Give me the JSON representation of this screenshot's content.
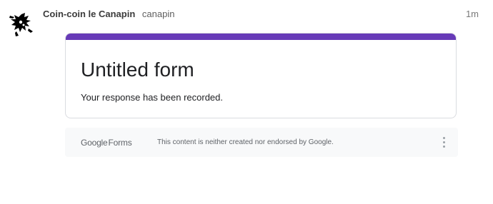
{
  "post": {
    "author_name": "Coin-coin le Canapin",
    "author_handle": "canapin",
    "timestamp": "1m",
    "avatar_icon": "abstract-figure-icon"
  },
  "form": {
    "title": "Untitled form",
    "confirmation": "Your response has been recorded.",
    "accent_color": "#673ab7"
  },
  "footer": {
    "brand_google": "Google",
    "brand_forms": "Forms",
    "disclaimer": "This content is neither created nor endorsed by Google.",
    "menu_icon": "more-vert-icon"
  }
}
